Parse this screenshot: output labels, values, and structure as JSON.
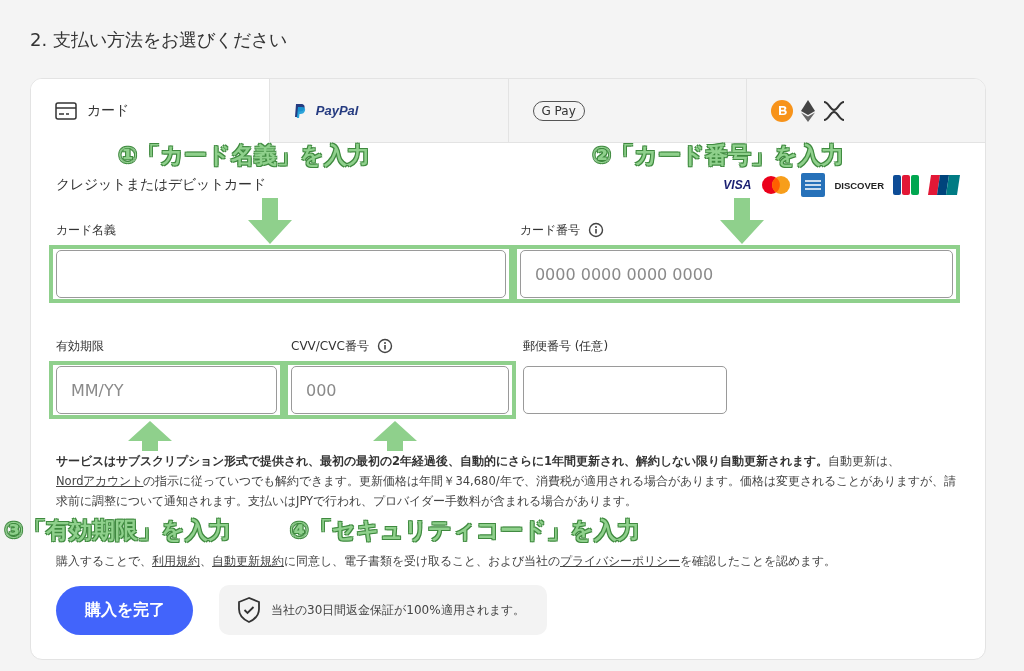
{
  "heading": "2. 支払い方法をお選びください",
  "tabs": [
    {
      "kind": "card",
      "label": "カード",
      "selected": true
    },
    {
      "kind": "paypal",
      "label": "PayPal",
      "selected": false
    },
    {
      "kind": "gpay",
      "label": "G Pay",
      "selected": false
    },
    {
      "kind": "crypto",
      "selected": false
    }
  ],
  "card_title": "クレジットまたはデビットカード",
  "card_brands": [
    {
      "kind": "visa",
      "label": "VISA"
    },
    {
      "kind": "mastercard"
    },
    {
      "kind": "amex"
    },
    {
      "kind": "discover",
      "label": "DISCOVER"
    },
    {
      "kind": "jcb"
    },
    {
      "kind": "unionpay"
    }
  ],
  "field_rows": [
    [
      {
        "label": "カード名義",
        "info": false,
        "highlighted": true
      },
      {
        "label": "カード番号",
        "info": true,
        "placeholder": "0000 0000 0000 0000",
        "highlighted": true
      }
    ],
    [
      {
        "label": "有効期限",
        "info": false,
        "placeholder": "MM/YY",
        "highlighted": true
      },
      {
        "label": "CVV/CVC番号",
        "info": true,
        "placeholder": "000",
        "highlighted": true
      },
      {
        "label": "郵便番号 (任意)",
        "info": false,
        "highlighted": false
      }
    ]
  ],
  "terms": [
    [
      {
        "kind": "bold",
        "text": "サービスはサブスクリプション形式で提供され、最初の最初の2年経過後、自動的にさらに1年間更新され、解約しない限り自動更新されます。"
      },
      {
        "kind": "plain",
        "text": "自動更新は、"
      },
      {
        "kind": "link",
        "text": "Nordアカウント"
      },
      {
        "kind": "plain",
        "text": "の指示に従っていつでも解約できます。更新価格は年間￥34,680/年で、消費税が適用される場合があります。価格は変更されることがありますが、請求前に調整について通知されます。支払いはJPYで行われ、プロバイダー手数料が含まれる場合があります。"
      }
    ],
    [
      {
        "kind": "plain",
        "text": "購入することで、"
      },
      {
        "kind": "link",
        "text": "利用規約"
      },
      {
        "kind": "plain",
        "text": "、"
      },
      {
        "kind": "link",
        "text": "自動更新規約"
      },
      {
        "kind": "plain",
        "text": "に同意し、電子書類を受け取ること、および当社の"
      },
      {
        "kind": "link",
        "text": "プライバシーポリシー"
      },
      {
        "kind": "plain",
        "text": "を確認したことを認めます。"
      }
    ]
  ],
  "submit_button": "購入を完了",
  "guarantee": "当社の30日間返金保証が100%適用されます。",
  "annotations": [
    {
      "text": "①「カード名義」を入力",
      "kind": "down"
    },
    {
      "text": "②「カード番号」を入力",
      "kind": "down"
    },
    {
      "text": "③「有効期限」を入力",
      "kind": "up"
    },
    {
      "text": "④「セキュリティコード」を入力",
      "kind": "up"
    }
  ]
}
